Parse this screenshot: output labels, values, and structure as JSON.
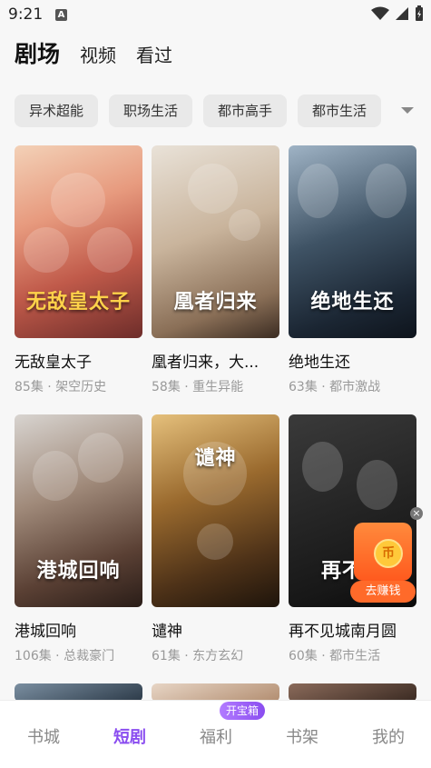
{
  "status": {
    "time": "9:21",
    "notif_letter": "A"
  },
  "top_tabs": [
    "剧场",
    "视频",
    "看过"
  ],
  "chips": [
    "异术超能",
    "职场生活",
    "都市高手",
    "都市生活"
  ],
  "cards": [
    {
      "title": "无敌皇太子",
      "meta": "85集 · 架空历史",
      "cover_text": "无敌皇太子"
    },
    {
      "title": "凰者归来，大...",
      "meta": "58集 · 重生异能",
      "cover_text": "凰者归来"
    },
    {
      "title": "绝地生还",
      "meta": "63集 · 都市激战",
      "cover_text": "绝地生还"
    },
    {
      "title": "港城回响",
      "meta": "106集 · 总裁豪门",
      "cover_text": "港城回响"
    },
    {
      "title": "谴神",
      "meta": "61集 · 东方玄幻",
      "cover_text": "谴神"
    },
    {
      "title": "再不见城南月圆",
      "meta": "60集 · 都市生活",
      "cover_text": "再不见"
    }
  ],
  "reward": {
    "label": "去赚钱",
    "coin": "币"
  },
  "bottom_nav": {
    "items": [
      "书城",
      "短剧",
      "福利",
      "书架",
      "我的"
    ],
    "badge": "开宝箱"
  },
  "colors": {
    "accent": "#8a4df0",
    "reward": "#ff6a2a"
  }
}
